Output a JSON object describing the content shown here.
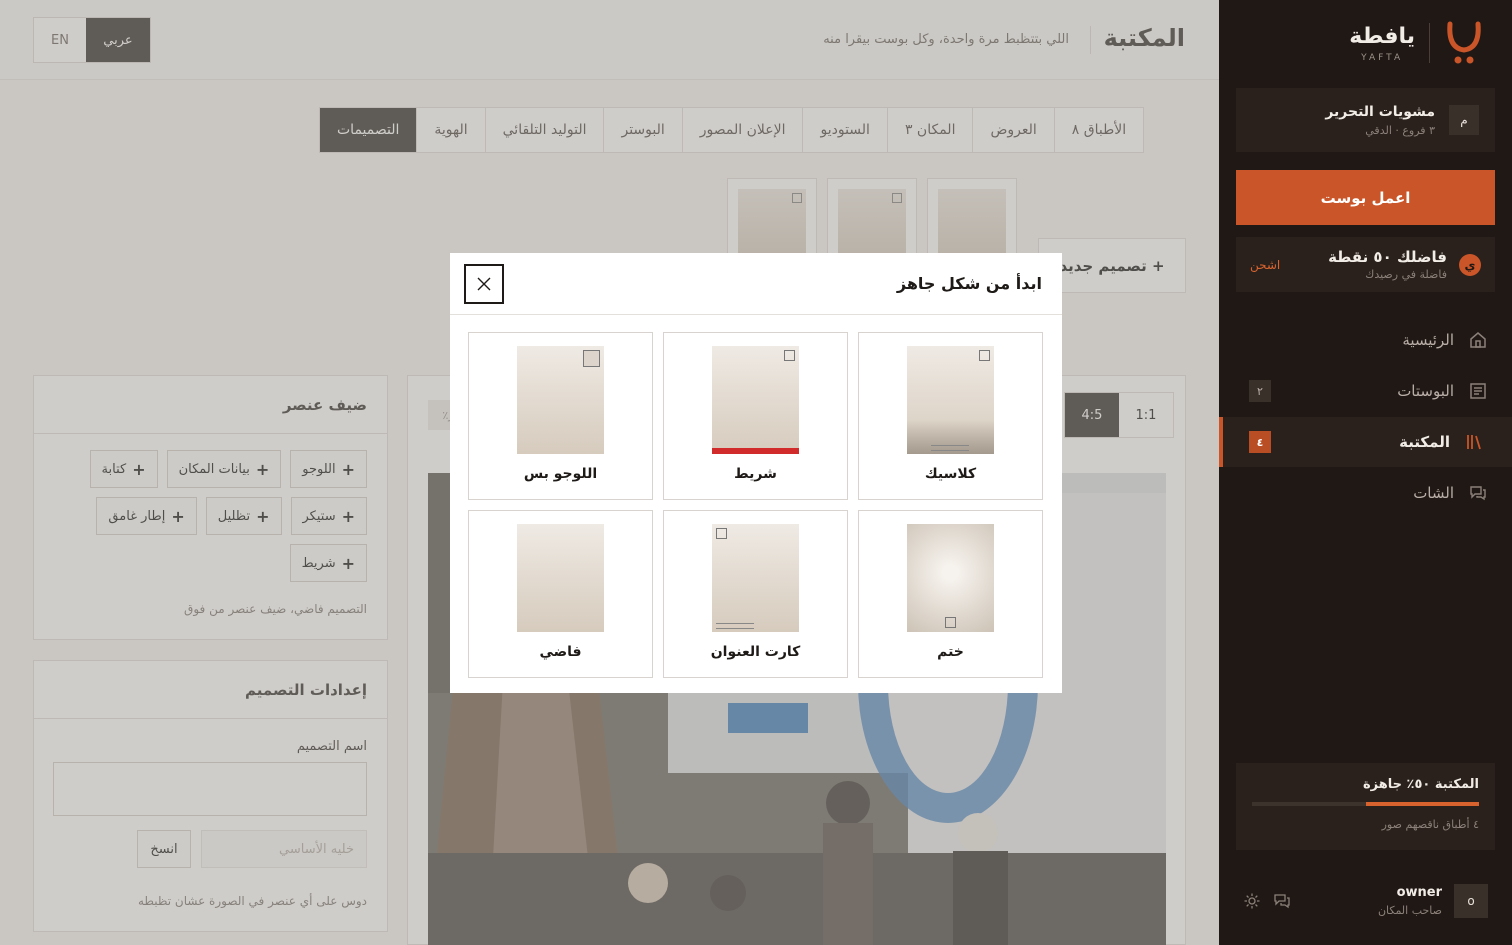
{
  "sidebar": {
    "brand_name": "يافطة",
    "brand_latin": "YAFTA",
    "drafts": {
      "avatar": "م",
      "title": "مشويات التحرير",
      "subtitle": "٣ فروع · الدقي"
    },
    "make_post": "اعمل بوست",
    "points": {
      "title": "فاضلك ٥٠ نقطة",
      "subtitle": "فاضلة في رصيدك",
      "charge": "اشحن"
    },
    "nav": [
      {
        "label": "الرئيسية",
        "icon": "home-icon",
        "badge": ""
      },
      {
        "label": "البوستات",
        "icon": "posts-icon",
        "badge": "٢"
      },
      {
        "label": "المكتبة",
        "icon": "library-icon",
        "badge": "٤"
      },
      {
        "label": "الشات",
        "icon": "chat-icon",
        "badge": ""
      }
    ],
    "progress": {
      "title": "المكتبة ٥٠٪ جاهزة",
      "fraction": 0.5,
      "subtitle": "٤ أطباق ناقصهم صور"
    },
    "user": {
      "avatar": "o",
      "name": "owner",
      "role": "صاحب المكان"
    },
    "accent": "#c95528"
  },
  "header": {
    "title": "المكتبة",
    "tagline": "اللي بتتظبط مرة واحدة، وكل بوست بيقرا منه",
    "lang_en": "EN",
    "lang_ar": "عربي"
  },
  "tabs": [
    {
      "label": "الأطباق ٨"
    },
    {
      "label": "العروض"
    },
    {
      "label": "المكان ٣"
    },
    {
      "label": "الستوديو"
    },
    {
      "label": "الإعلان المصور"
    },
    {
      "label": "البوستر"
    },
    {
      "label": "التوليد التلقائي"
    },
    {
      "label": "الهوية"
    },
    {
      "label": "التصميمات"
    }
  ],
  "new_design": "+ تصميم جديد",
  "add_element": {
    "title": "ضيف عنصر",
    "chips": [
      "اللوجو",
      "بيانات المكان",
      "كتابة",
      "ستيكر",
      "تظليل",
      "إطار غامق",
      "شريط"
    ],
    "hint": "التصميم فاضي، ضيف عنصر من فوق"
  },
  "settings": {
    "title": "إعدادات التصميم",
    "name_label": "اسم التصميم",
    "base_placeholder": "خليه الأساسي",
    "copy": "انسخ",
    "hint": "دوس على أي عنصر في الصورة عشان تظبطه"
  },
  "canvas": {
    "ratio_1": "1:1",
    "ratio_2": "4:5",
    "pct": "٪ر"
  },
  "modal": {
    "title": "ابدأ من شكل جاهز",
    "templates": [
      {
        "name": "كلاسيك"
      },
      {
        "name": "شريط"
      },
      {
        "name": "اللوجو بس"
      },
      {
        "name": "ختم"
      },
      {
        "name": "كارت العنوان"
      },
      {
        "name": "فاضي"
      }
    ]
  }
}
